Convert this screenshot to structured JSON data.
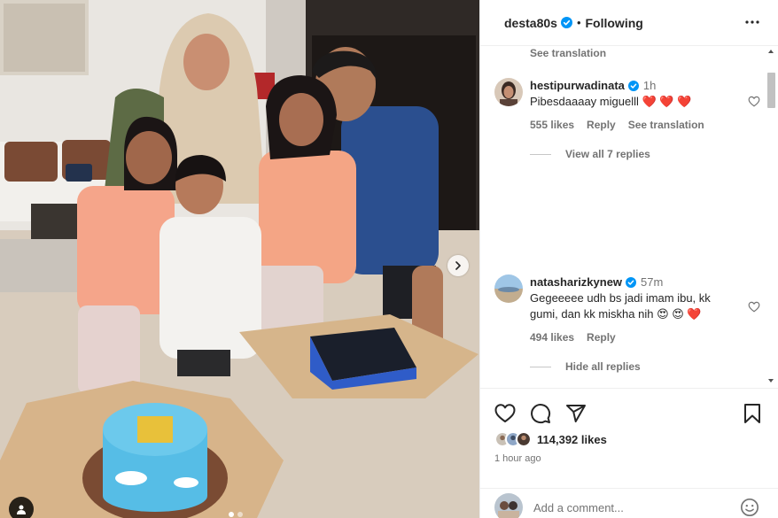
{
  "post": {
    "username": "desta80s",
    "follow_status": "Following",
    "separator": "•"
  },
  "comments_section": {
    "top_see_translation": "See translation",
    "comments": [
      {
        "username": "hestipurwadinata",
        "time": "1h",
        "text": "Pibesdaaaay miguelll",
        "emoji": "❤️ ❤️ ❤️",
        "likes": "555 likes",
        "reply": "Reply",
        "see_translation": "See translation",
        "replies": "View all 7 replies"
      },
      {
        "username": "natasharizkynew",
        "time": "57m",
        "text": "Gegeeeee udh bs jadi imam ibu, kk gumi, dan kk miskha nih",
        "emoji": "😍 😍 ❤️",
        "likes": "494 likes",
        "reply": "Reply",
        "replies": "Hide all replies"
      }
    ]
  },
  "actions": {
    "likes": "114,392 likes",
    "time_ago": "1 hour ago",
    "add_comment_placeholder": "Add a comment..."
  },
  "icons": {
    "verified": "verified-badge-icon",
    "more": "more-options-icon",
    "like": "heart-icon",
    "comment": "comment-icon",
    "share": "share-icon",
    "save": "bookmark-icon",
    "next": "chevron-right-icon",
    "tag": "user-tag-icon",
    "emoji": "emoji-icon"
  },
  "colors": {
    "verified_blue": "#0095f6",
    "heart_red": "#ed1c24",
    "text_primary": "#262626",
    "text_secondary": "#737373"
  }
}
